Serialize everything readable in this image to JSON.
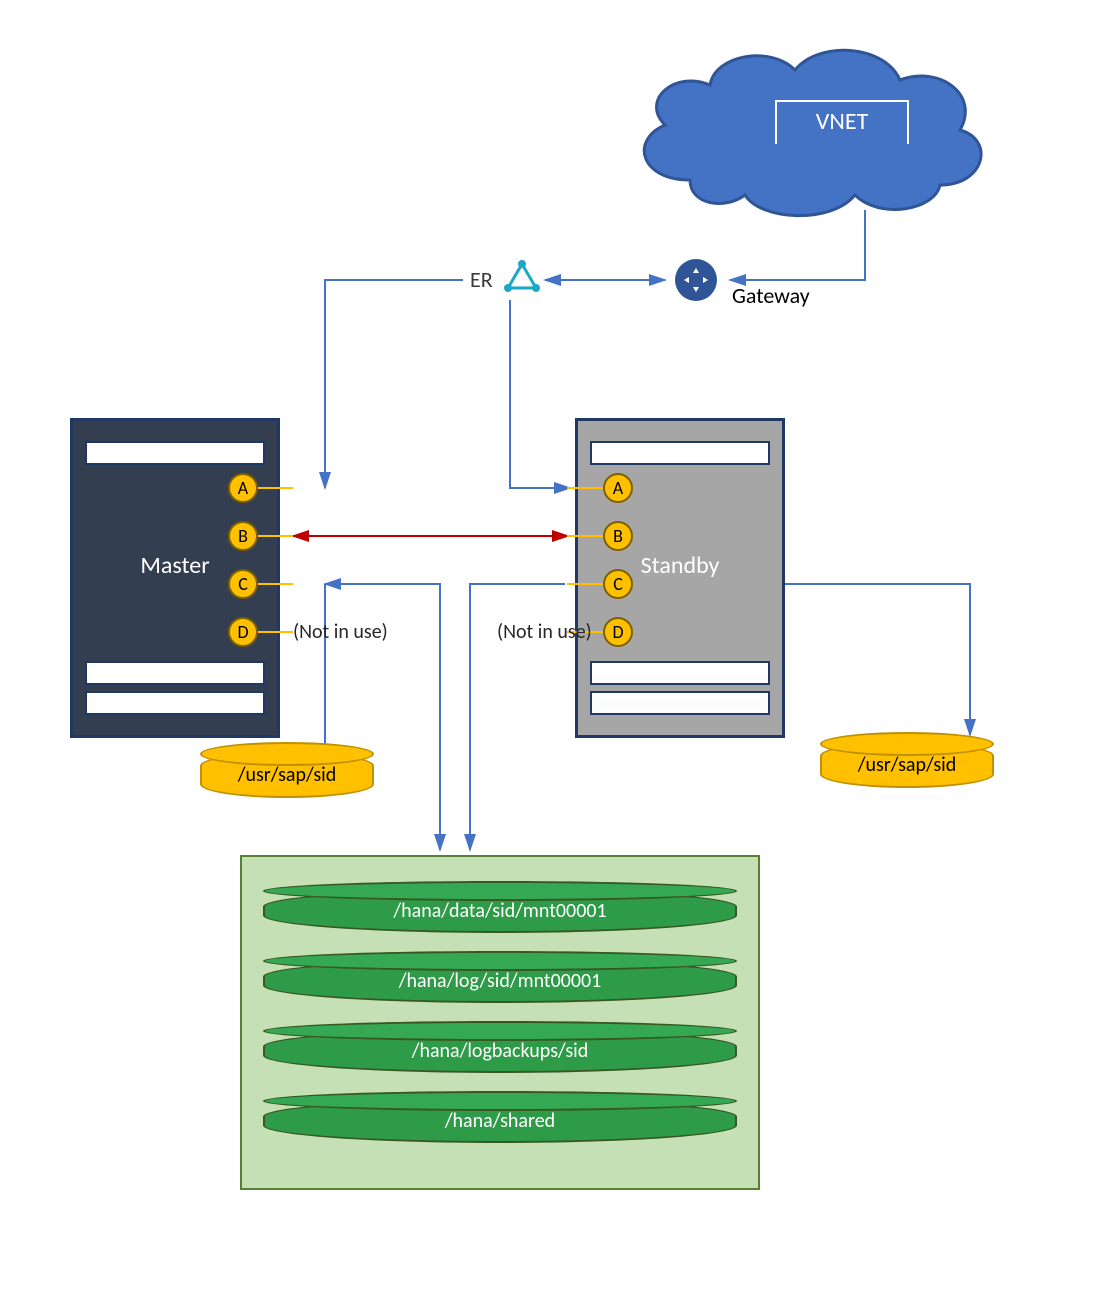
{
  "cloud": {
    "label": "VNET"
  },
  "network": {
    "er_label": "ER",
    "gateway_label": "Gateway"
  },
  "servers": {
    "master": {
      "name": "Master",
      "local_disk": "/usr/sap/sid"
    },
    "standby": {
      "name": "Standby",
      "local_disk": "/usr/sap/sid"
    }
  },
  "ports": {
    "a": "A",
    "b": "B",
    "c": "C",
    "d": "D",
    "d_note": "(Not in use)"
  },
  "shared_storage": [
    "/hana/data/sid/mnt00001",
    "/hana/log/sid/mnt00001",
    "/hana/logbackups/sid",
    "/hana/shared"
  ],
  "colors": {
    "blue_dark": "#2F5597",
    "slate": "#333F50",
    "gray": "#A6A6A6",
    "navy": "#203864",
    "amber": "#FFC000",
    "green": "#2E9B48",
    "green_light": "#C5E0B4",
    "connector_blue": "#4472C4",
    "connector_red": "#C00000",
    "cyan": "#1BA8C4"
  }
}
